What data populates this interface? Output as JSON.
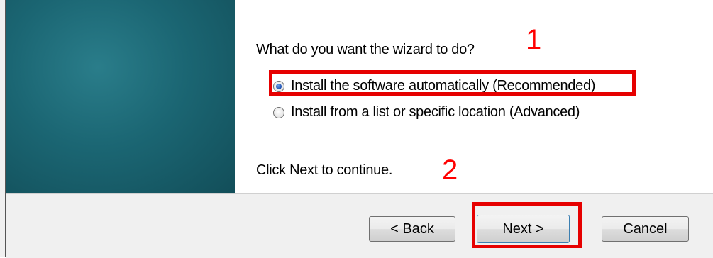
{
  "wizard": {
    "question": "What do you want the wizard to do?",
    "options": [
      {
        "label": "Install the software automatically (Recommended)",
        "selected": true
      },
      {
        "label": "Install from a list or specific location (Advanced)",
        "selected": false
      }
    ],
    "hint": "Click Next to continue."
  },
  "annotations": {
    "step1": "1",
    "step2": "2",
    "color": "#ff0000"
  },
  "buttons": {
    "back": "< Back",
    "next": "Next >",
    "cancel": "Cancel"
  }
}
